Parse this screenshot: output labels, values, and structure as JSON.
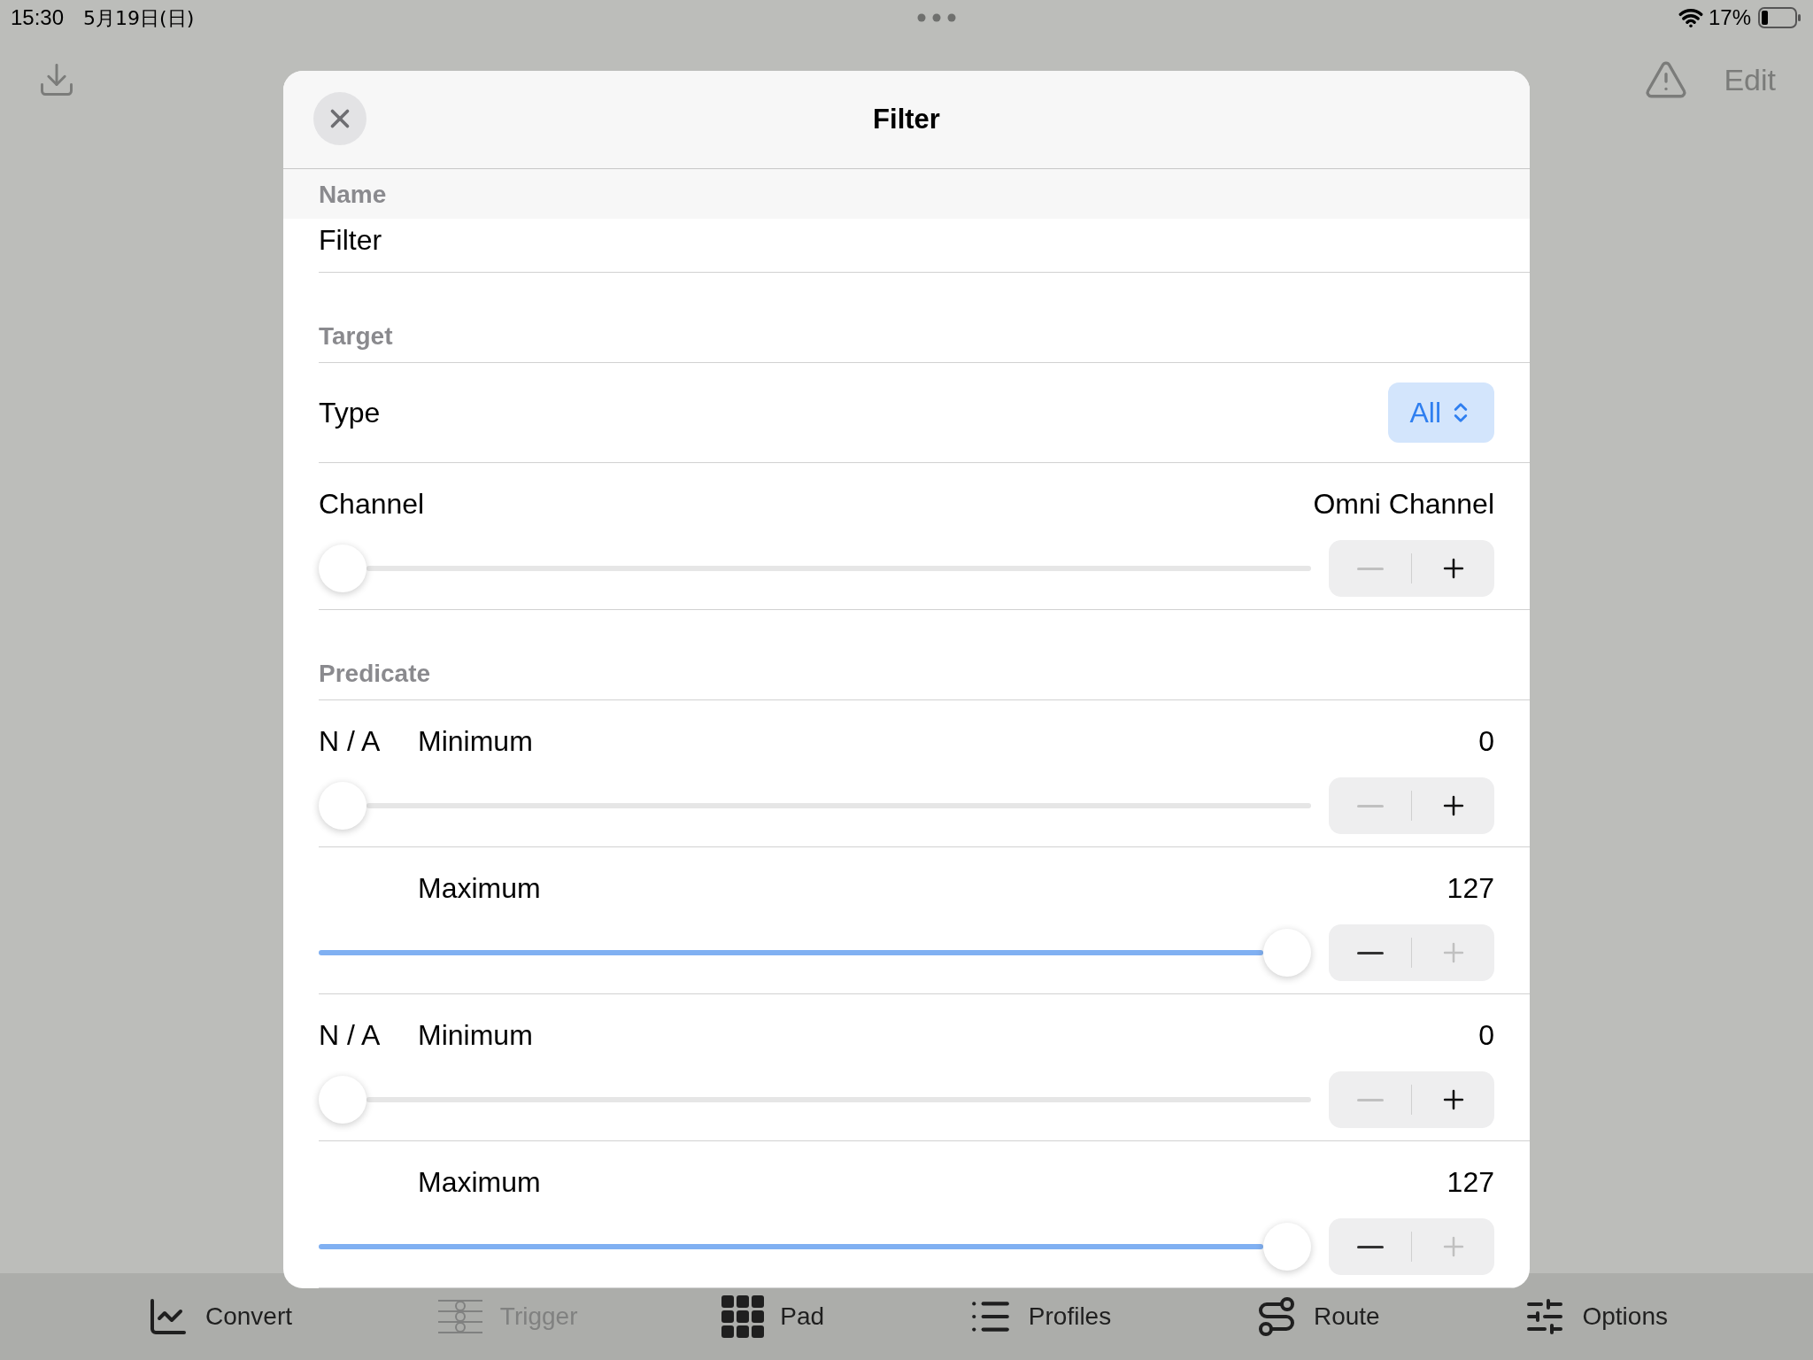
{
  "status_bar": {
    "time": "15:30",
    "date": "5月19日(日)",
    "battery": "17%"
  },
  "nav_bar": {
    "trailing_button": "Edit"
  },
  "modal": {
    "title": "Filter",
    "name": {
      "header": "Name",
      "value": "Filter"
    },
    "target": {
      "header": "Target",
      "type": {
        "label": "Type",
        "value": "All"
      },
      "channel": {
        "label": "Channel",
        "reading": "Omni Channel",
        "level": 0,
        "minus_disabled": true,
        "plus_disabled": false
      }
    },
    "predicate": {
      "header": "Predicate",
      "rows": [
        {
          "prefix": "N / A",
          "label": "Minimum",
          "reading": "0",
          "level": 0,
          "minus_disabled": true,
          "plus_disabled": false
        },
        {
          "label": "Maximum",
          "reading": "127",
          "level": 1,
          "minus_disabled": false,
          "plus_disabled": true
        },
        {
          "prefix": "N / A",
          "label": "Minimum",
          "reading": "0",
          "level": 0,
          "minus_disabled": true,
          "plus_disabled": false
        },
        {
          "label": "Maximum",
          "reading": "127",
          "level": 1,
          "minus_disabled": false,
          "plus_disabled": true
        }
      ]
    }
  },
  "tab_bar": [
    {
      "kind": "convert",
      "label": "Convert",
      "disabled": false
    },
    {
      "kind": "trigger",
      "label": "Trigger",
      "disabled": true
    },
    {
      "kind": "pad",
      "label": "Pad",
      "disabled": false
    },
    {
      "kind": "profiles",
      "label": "Profiles",
      "disabled": false
    },
    {
      "kind": "route",
      "label": "Route",
      "disabled": false
    },
    {
      "kind": "options",
      "label": "Options",
      "disabled": false
    }
  ]
}
